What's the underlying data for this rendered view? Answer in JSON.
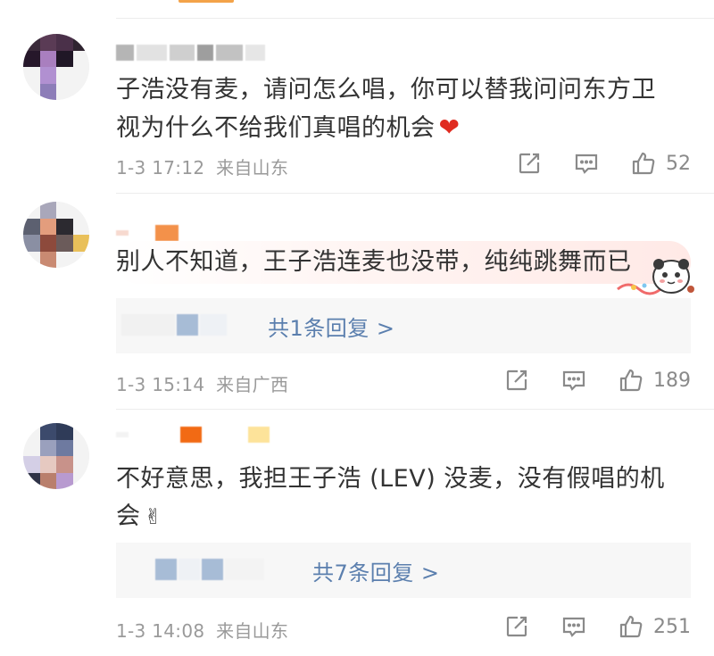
{
  "comments": [
    {
      "text_line1": "子浩没有麦，请问怎么唱，你可以替我问问东方卫",
      "text_line2": "视为什么不给我们真唱的机会",
      "emoji": "❤",
      "date": "1-3",
      "time": "17:12",
      "location": "来自山东",
      "likes": "52"
    },
    {
      "text_line1": "别人不知道，王子浩连麦也没带，纯纯跳舞而已",
      "reply_text": "共1条回复 >",
      "date": "1-3",
      "time": "15:14",
      "location": "来自广西",
      "likes": "189"
    },
    {
      "text_line1": "不好意思，我担王子浩 (LEV) 没麦，没有假唱的机",
      "text_line2": "会",
      "emoji": "✌",
      "reply_text": "共7条回复 >",
      "date": "1-3",
      "time": "14:08",
      "location": "来自山东",
      "likes": "251"
    }
  ],
  "icons": {
    "forward": "share-box-icon",
    "comment": "comment-bubble-icon",
    "like": "thumb-up-icon"
  },
  "colors": {
    "link": "#5b7fae",
    "meta": "#9a9a9a",
    "text": "#333333",
    "heart": "#e02b20"
  }
}
